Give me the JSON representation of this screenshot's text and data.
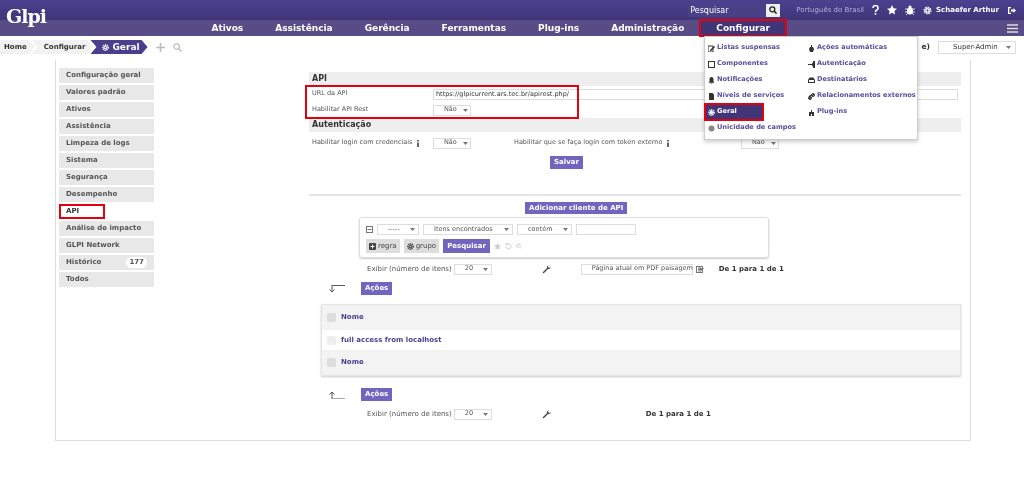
{
  "header": {
    "logo": "Glpi",
    "search": {
      "placeholder": "Pesquisar"
    },
    "language": "Português do Brasil",
    "user": "Schaefer Arthur"
  },
  "menu": [
    {
      "label": "Ativos",
      "selected": false,
      "highlighted": false
    },
    {
      "label": "Assistência",
      "selected": false,
      "highlighted": false
    },
    {
      "label": "Gerência",
      "selected": false,
      "highlighted": false
    },
    {
      "label": "Ferramentas",
      "selected": false,
      "highlighted": false
    },
    {
      "label": "Plug-ins",
      "selected": false,
      "highlighted": false
    },
    {
      "label": "Administração",
      "selected": false,
      "highlighted": false
    },
    {
      "label": "Configurar",
      "selected": true,
      "highlighted": true
    }
  ],
  "breadcrumb": [
    {
      "label": "Home",
      "current": false
    },
    {
      "label": "Configurar",
      "current": false
    },
    {
      "label": "Geral",
      "current": true
    }
  ],
  "profile": {
    "entity_fragment": "e)",
    "value": "Super-Admin"
  },
  "dropdown": {
    "columns": [
      [
        {
          "label": "Listas suspensas",
          "selected": false,
          "highlighted": false
        },
        {
          "label": "Componentes",
          "selected": false,
          "highlighted": false
        },
        {
          "label": "Notificações",
          "selected": false,
          "highlighted": false
        },
        {
          "label": "Níveis de serviços",
          "selected": false,
          "highlighted": false
        },
        {
          "label": "Geral",
          "selected": true,
          "highlighted": true
        },
        {
          "label": "Unicidade de campos",
          "selected": false,
          "highlighted": false
        }
      ],
      [
        {
          "label": "Ações automáticas",
          "selected": false,
          "highlighted": false
        },
        {
          "label": "Autenticação",
          "selected": false,
          "highlighted": false
        },
        {
          "label": "Destinatários",
          "selected": false,
          "highlighted": false
        },
        {
          "label": "Relacionamentos externos",
          "selected": false,
          "highlighted": false
        },
        {
          "label": "Plug-ins",
          "selected": false,
          "highlighted": false
        }
      ]
    ]
  },
  "sidebar": [
    {
      "label": "Configuração geral",
      "selected": false,
      "highlighted": false
    },
    {
      "label": "Valores padrão",
      "selected": false,
      "highlighted": false
    },
    {
      "label": "Ativos",
      "selected": false,
      "highlighted": false
    },
    {
      "label": "Assistência",
      "selected": false,
      "highlighted": false
    },
    {
      "label": "Limpeza de logs",
      "selected": false,
      "highlighted": false
    },
    {
      "label": "Sistema",
      "selected": false,
      "highlighted": false
    },
    {
      "label": "Segurança",
      "selected": false,
      "highlighted": false
    },
    {
      "label": "Desempenho",
      "selected": false,
      "highlighted": false
    },
    {
      "label": "API",
      "selected": true,
      "highlighted": true
    },
    {
      "label": "Análise de impacto",
      "selected": false,
      "highlighted": false
    },
    {
      "label": "GLPI Network",
      "selected": false,
      "highlighted": false
    },
    {
      "label": "Histórico",
      "selected": false,
      "highlighted": false,
      "count": "177"
    },
    {
      "label": "Todos",
      "selected": false,
      "highlighted": false
    }
  ],
  "api_section": {
    "title": "API",
    "highlighted": true,
    "fields": [
      {
        "label": "URL da API",
        "kind": "text",
        "value": "https://glpicurrent.ars.tec.br/apirest.php/"
      },
      {
        "label": "Habilitar API Rest",
        "kind": "select",
        "value": "Não"
      }
    ]
  },
  "auth_section": {
    "title": "Autenticação",
    "fields": [
      {
        "label": "Habilitar login com credenciais",
        "kind": "select",
        "value": "Não"
      },
      {
        "label": "Habilitar que se faça login com token externo",
        "kind": "select",
        "value": "Não"
      }
    ]
  },
  "save_button": "Salvar",
  "add_button": "Adicionar cliente de API",
  "search_criteria": {
    "field": "-----",
    "criterion": "Itens encontrados",
    "operator": "contém",
    "rule_button": "regra",
    "group_button": "grupo",
    "search_button": "Pesquisar"
  },
  "pager_top": {
    "display_label": "Exibir (número de itens)",
    "per_page": "20",
    "export": "Página atual em PDF paisagem",
    "range": "De 1 para 1 de 1"
  },
  "actions_top": "Ações",
  "table": {
    "header": "Nome",
    "header_checked": false,
    "footer_checked": false,
    "rows": [
      {
        "name": "full access from localhost",
        "checked": false
      }
    ],
    "footer": "Nome"
  },
  "actions_bottom": "Ações",
  "pager_bottom": {
    "display_label": "Exibir (número de itens)",
    "per_page": "20",
    "range": "De 1 para 1 de 1"
  }
}
